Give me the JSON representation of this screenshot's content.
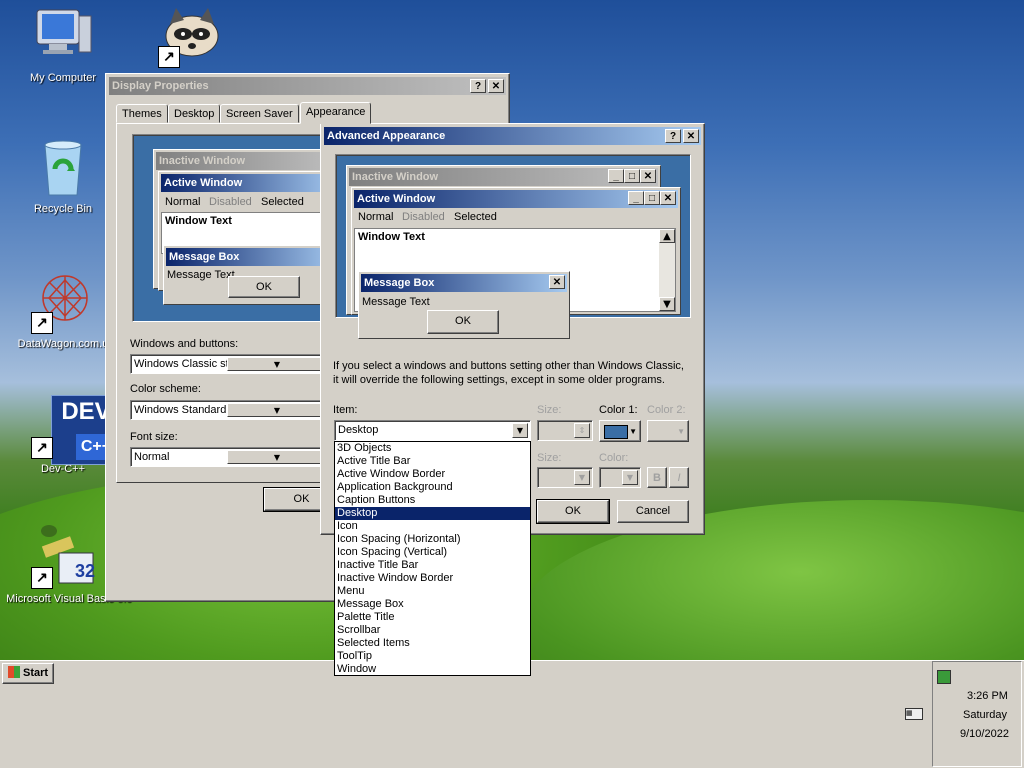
{
  "desktop": {
    "icons": [
      {
        "label": "My Computer"
      },
      {
        "label": "Recycle Bin"
      },
      {
        "label": "DataWagon.com.u"
      },
      {
        "label": "Dev-C++"
      },
      {
        "label": "Microsoft Visual Basic 6.0"
      }
    ],
    "dev_icon_text": "DEV",
    "dev_icon_subtext": "C++",
    "vb_icon_text": "32"
  },
  "display_properties": {
    "title": "Display Properties",
    "tabs": [
      "Themes",
      "Desktop",
      "Screen Saver",
      "Appearance"
    ],
    "preview": {
      "inactive_title": "Inactive Window",
      "active_title": "Active Window",
      "menu": [
        "Normal",
        "Disabled",
        "Selected"
      ],
      "window_text": "Window Text",
      "message_box_title": "Message Box",
      "message_text": "Message Text",
      "ok": "OK"
    },
    "windows_buttons_label": "Windows and buttons:",
    "windows_buttons_value": "Windows Classic st",
    "color_scheme_label": "Color scheme:",
    "color_scheme_value": "Windows Standard",
    "font_size_label": "Font size:",
    "font_size_value": "Normal",
    "ok": "OK"
  },
  "advanced": {
    "title": "Advanced Appearance",
    "preview": {
      "inactive_title": "Inactive Window",
      "active_title": "Active Window",
      "menu": [
        "Normal",
        "Disabled",
        "Selected"
      ],
      "window_text": "Window Text",
      "message_box_title": "Message Box",
      "message_text": "Message Text",
      "ok": "OK"
    },
    "info_line1": "If you select a windows and buttons setting other than Windows Classic,",
    "info_line2": "it will override the following settings, except in some older programs.",
    "item_label": "Item:",
    "item_value": "Desktop",
    "size_label": "Size:",
    "color1_label": "Color 1:",
    "color2_label": "Color 2:",
    "font_size_label": "Size:",
    "font_color_label": "Color:",
    "bold": "B",
    "italic": "I",
    "ok": "OK",
    "cancel": "Cancel",
    "color1_value": "#3a6ea5",
    "items": [
      "3D Objects",
      "Active Title Bar",
      "Active Window Border",
      "Application Background",
      "Caption Buttons",
      "Desktop",
      "Icon",
      "Icon Spacing (Horizontal)",
      "Icon Spacing (Vertical)",
      "Inactive Title Bar",
      "Inactive Window Border",
      "Menu",
      "Message Box",
      "Palette Title",
      "Scrollbar",
      "Selected Items",
      "ToolTip",
      "Window"
    ],
    "selected_item": "Desktop"
  },
  "taskbar": {
    "start": "Start",
    "time": "3:26 PM",
    "day": "Saturday",
    "date": "9/10/2022"
  },
  "colors": {
    "title_active": "#0a246a",
    "desktop_preview": "#3a6ea5",
    "face": "#d4d0c8"
  }
}
